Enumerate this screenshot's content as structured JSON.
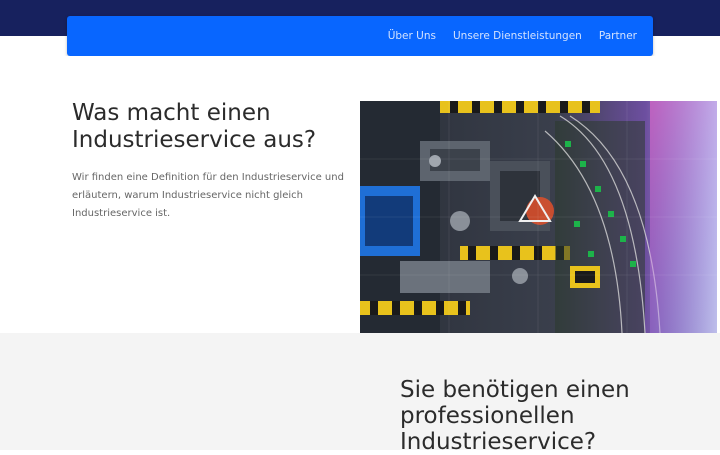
{
  "nav": {
    "links": [
      {
        "label": "Über Uns"
      },
      {
        "label": "Unsere Dienstleistungen"
      },
      {
        "label": "Partner"
      }
    ]
  },
  "hero": {
    "title": "Was macht einen Industrieservice aus?",
    "text": "Wir finden eine Definition für den Industrieservice und erläutern, warum Industrieservice nicht gleich Industrieservice ist."
  },
  "section_two": {
    "title": "Sie benötigen einen professionellen Industrieservice?"
  },
  "colors": {
    "top_strip": "#17215e",
    "navbar": "#0866ff",
    "nav_link": "#d3e2ff",
    "section_bg": "#f4f4f4"
  }
}
